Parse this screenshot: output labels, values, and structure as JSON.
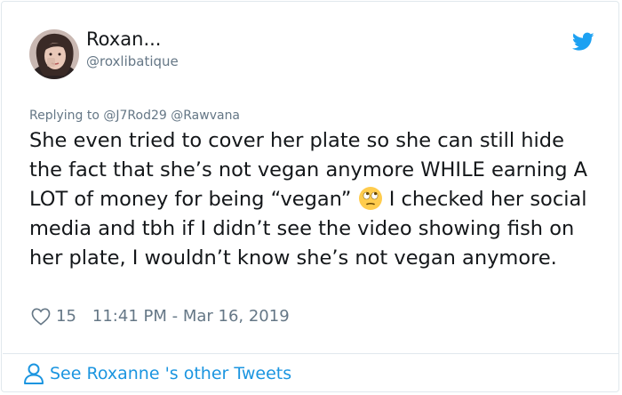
{
  "author": {
    "display_name": "Roxan...",
    "handle": "@roxlibatique"
  },
  "reply": {
    "prefix": "Replying to",
    "mentions": [
      "@J7Rod29",
      "@Rawvana"
    ]
  },
  "tweet": {
    "text_before_emoji": "She even tried to cover her plate so she can still hide the fact that she’s not vegan anymore WHILE earning A LOT of money for being “vegan”",
    "emoji": "face-with-rolling-eyes",
    "text_after_emoji": "I checked her social media and tbh if I didn’t see the video showing fish on her plate, I wouldn’t know she’s not vegan anymore."
  },
  "meta": {
    "likes": "15",
    "timestamp": "11:41 PM - Mar 16, 2019"
  },
  "footer": {
    "link_text": "See Roxanne 's other Tweets"
  },
  "colors": {
    "brand_blue": "#1da1f2",
    "link_blue": "#1b95e0",
    "muted_gray": "#657786",
    "text": "#14171a",
    "border": "#e1e8ed"
  }
}
